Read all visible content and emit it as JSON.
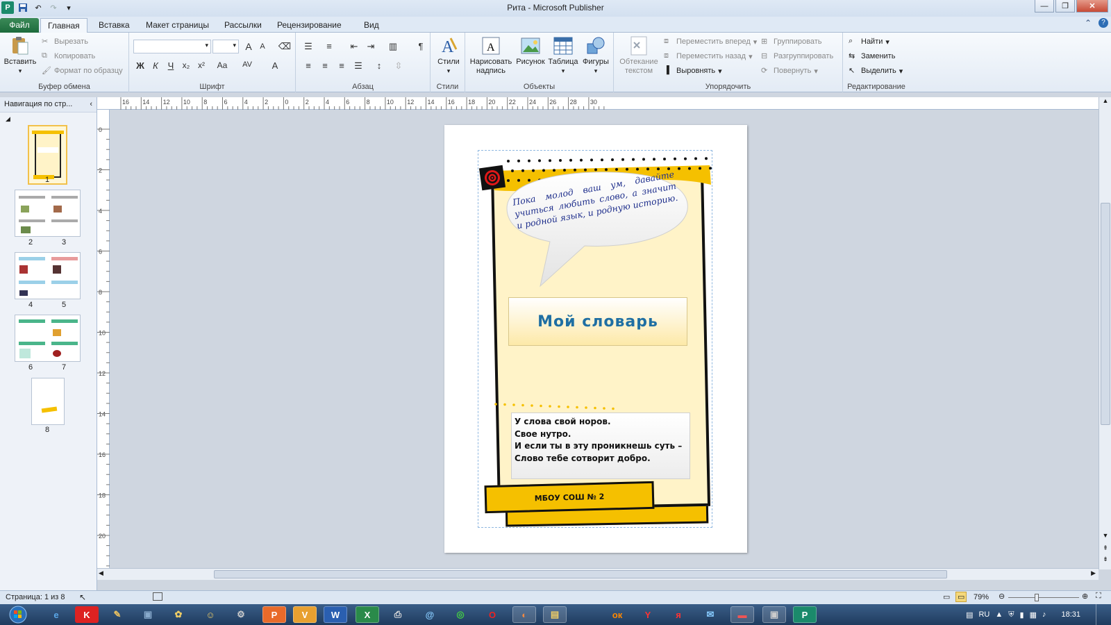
{
  "window": {
    "title": "Рита  -  Microsoft Publisher",
    "app_icon": "P",
    "controls": [
      "minimize",
      "maximize",
      "close"
    ]
  },
  "ribbon": {
    "tabs": [
      "Файл",
      "Главная",
      "Вставка",
      "Макет страницы",
      "Рассылки",
      "Рецензирование",
      "Вид"
    ],
    "active_tab": "Главная",
    "clipboard": {
      "label": "Буфер обмена",
      "paste": "Вставить",
      "cut": "Вырезать",
      "copy": "Копировать",
      "format_painter": "Формат по образцу"
    },
    "font": {
      "label": "Шрифт",
      "bold": "Ж",
      "italic": "К",
      "underline": "Ч",
      "subscript": "x₂",
      "superscript": "x²",
      "case": "Aa",
      "grow": "A",
      "shrink": "A",
      "color": "A",
      "spacing": "AV"
    },
    "paragraph": {
      "label": "Абзац",
      "pilcrow": "¶"
    },
    "styles": {
      "label": "Стили",
      "button": "Стили"
    },
    "objects": {
      "label": "Объекты",
      "textbox_line1": "Нарисовать",
      "textbox_line2": "надпись",
      "picture": "Рисунок",
      "table": "Таблица",
      "shapes": "Фигуры"
    },
    "arrange": {
      "label": "Упорядочить",
      "wrap_line1": "Обтекание",
      "wrap_line2": "текстом",
      "forward": "Переместить вперед",
      "backward": "Переместить назад",
      "align": "Выровнять",
      "group": "Группировать",
      "ungroup": "Разгруппировать",
      "rotate": "Повернуть"
    },
    "editing": {
      "label": "Редактирование",
      "find": "Найти",
      "replace": "Заменить",
      "select": "Выделить"
    }
  },
  "nav_pane": {
    "title": "Навигация по стр...",
    "pages": [
      "1",
      "2",
      "3",
      "4",
      "5",
      "6",
      "7",
      "8"
    ]
  },
  "ruler": {
    "h_labels": [
      "16",
      "14",
      "12",
      "10",
      "8",
      "6",
      "4",
      "2",
      "0",
      "2",
      "4",
      "6",
      "8",
      "10",
      "12",
      "14",
      "16",
      "18",
      "20",
      "22",
      "24",
      "26",
      "28",
      "30"
    ],
    "v_labels": [
      "0",
      "2",
      "4",
      "6",
      "8",
      "10",
      "12",
      "14",
      "16",
      "18",
      "20"
    ]
  },
  "document": {
    "bubble_text": "Пока молод ваш ум, давайте учиться любить слово, а значит и родной язык, и родную историю.",
    "title": "Мой словарь",
    "poem_lines": [
      "У слова свой норов.",
      "Свое нутро.",
      "И если ты в эту проникнешь суть –",
      "Слово тебе сотворит добро."
    ],
    "school": "МБОУ СОШ № 2"
  },
  "status": {
    "page_info": "Страница: 1 из 8",
    "zoom": "79%"
  },
  "taskbar": {
    "lang": "RU",
    "time": "18:31"
  },
  "colors": {
    "accent_yellow": "#f5c000",
    "cream": "#fff3c8",
    "title_blue": "#1f6fa3",
    "bubble_text": "#1f2f8c",
    "ribbon_file": "#1d6b3c"
  }
}
